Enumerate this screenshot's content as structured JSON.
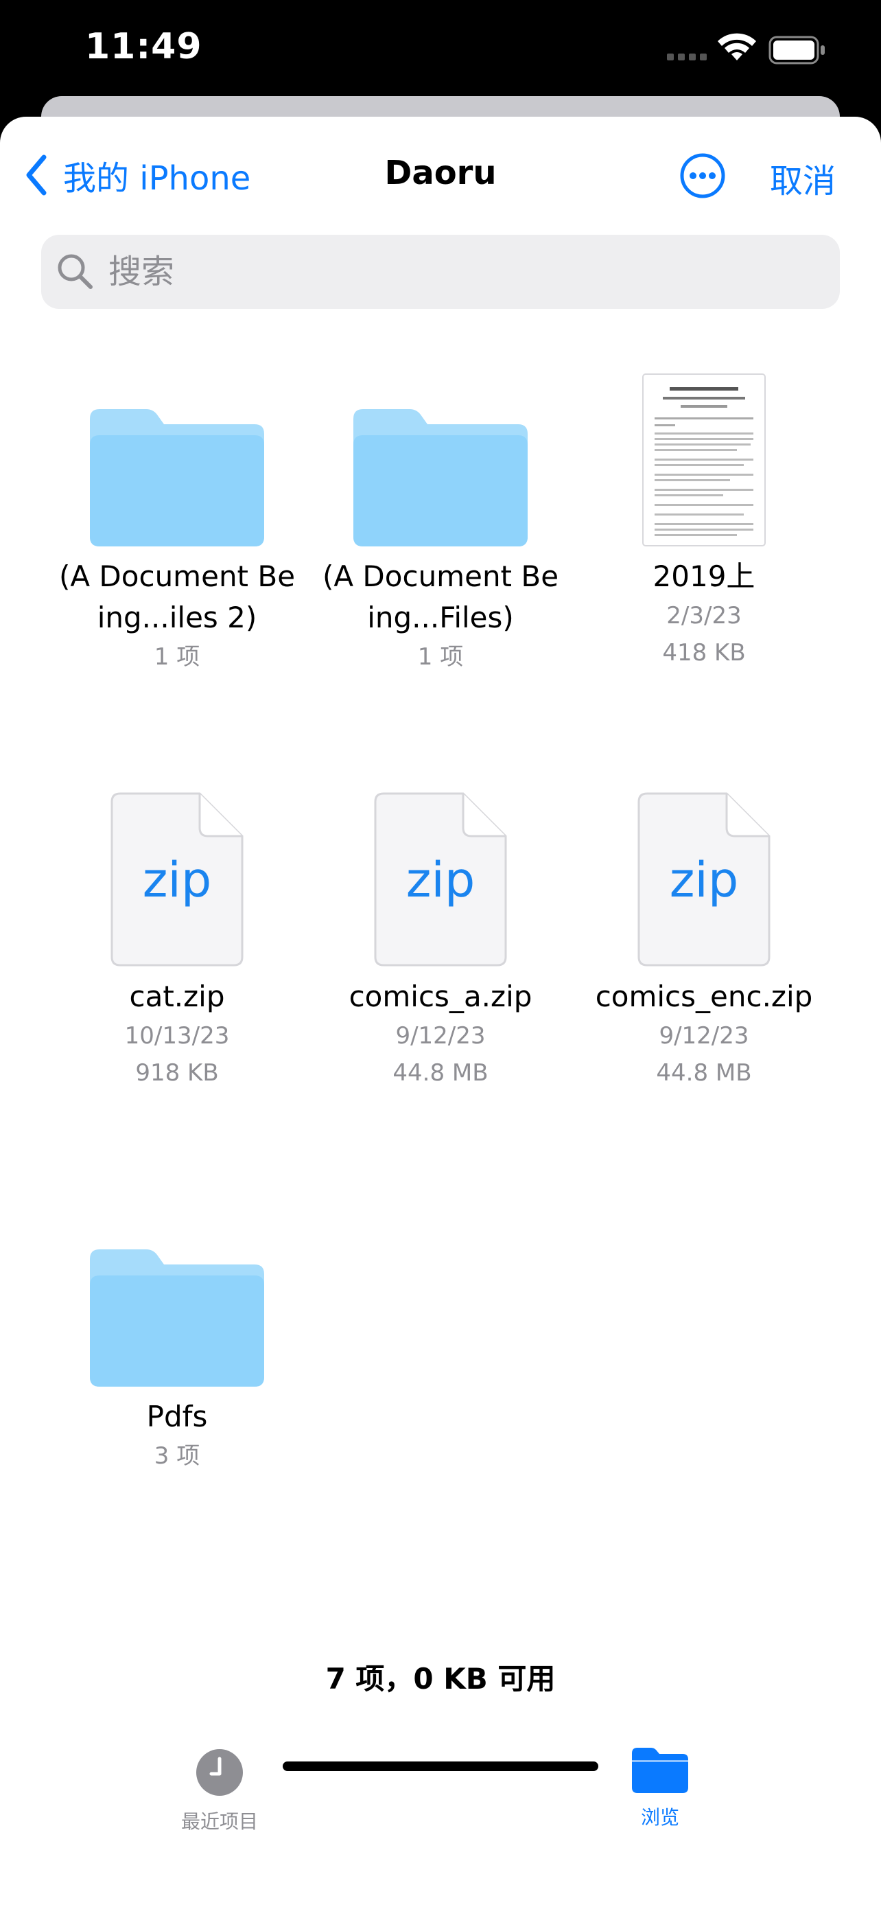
{
  "status_bar": {
    "time": "11:49"
  },
  "nav": {
    "back_label": "我的 iPhone",
    "title": "Daoru",
    "cancel_label": "取消"
  },
  "search": {
    "placeholder": "搜索",
    "value": ""
  },
  "items": [
    {
      "type": "folder",
      "name": "(A Document Being...iles 2)",
      "line1": "1 项",
      "line2": ""
    },
    {
      "type": "folder",
      "name": "(A Document Being...Files)",
      "line1": "1 项",
      "line2": ""
    },
    {
      "type": "document",
      "name": "2019上",
      "line1": "2/3/23",
      "line2": "418 KB"
    },
    {
      "type": "zip",
      "name": "cat.zip",
      "line1": "10/13/23",
      "line2": "918 KB"
    },
    {
      "type": "zip",
      "name": "comics_a.zip",
      "line1": "9/12/23",
      "line2": "44.8 MB"
    },
    {
      "type": "zip",
      "name": "comics_enc.zip",
      "line1": "9/12/23",
      "line2": "44.8 MB"
    },
    {
      "type": "folder",
      "name": "Pdfs",
      "line1": "3 项",
      "line2": ""
    }
  ],
  "zip_icon_text": "zip",
  "footer": {
    "count_text": "7 项，0 KB 可用"
  },
  "tabs": [
    {
      "label": "最近项目",
      "icon": "clock-icon",
      "active": false
    },
    {
      "label": "浏览",
      "icon": "folder-icon",
      "active": true
    }
  ],
  "colors": {
    "accent": "#0a7aff",
    "folder": "#8fd3fb",
    "folder_tab": "#a6dcfb",
    "secondary_text": "#8e8e93",
    "inactive_tab": "#8e8e93"
  }
}
